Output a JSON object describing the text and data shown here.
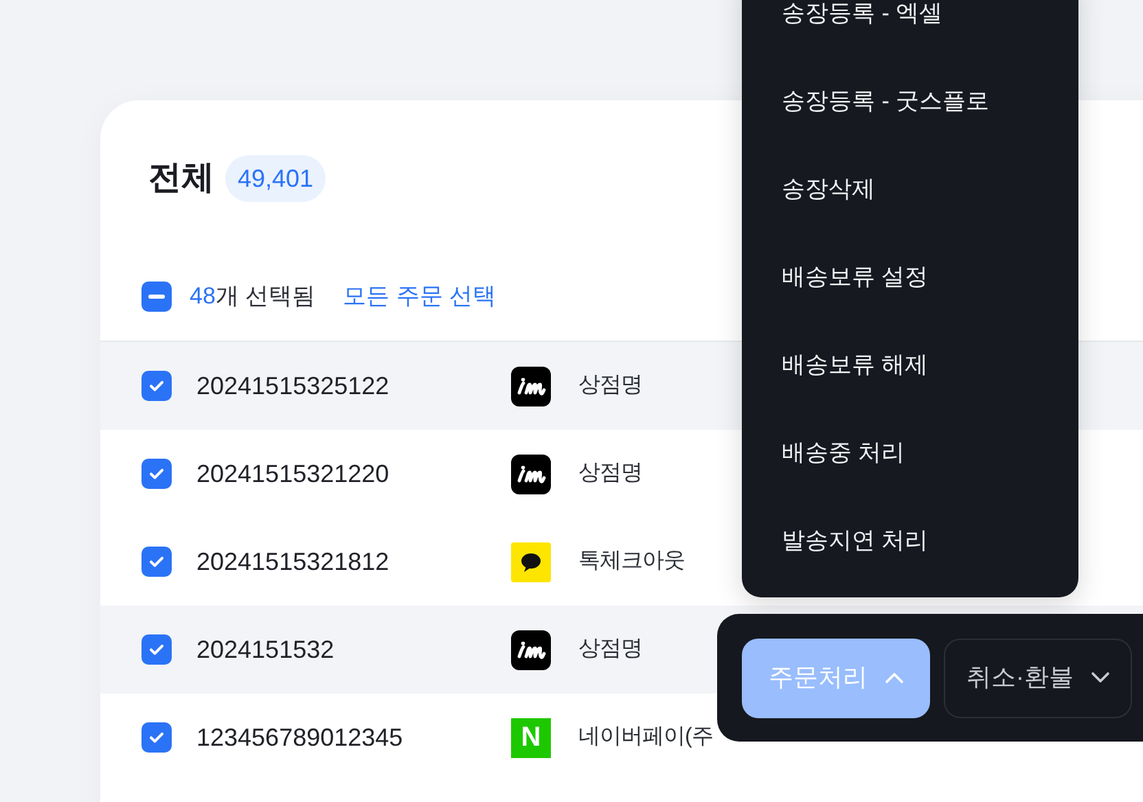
{
  "header": {
    "title": "전체",
    "count": "49,401"
  },
  "selection": {
    "partial": true,
    "count": "48",
    "suffix": "개 선택됨",
    "select_all": "모든 주문 선택"
  },
  "rows": [
    {
      "checked": true,
      "highlighted": true,
      "order_no": "20241515325122",
      "store": {
        "kind": "black",
        "name": "상점명"
      }
    },
    {
      "checked": true,
      "highlighted": false,
      "order_no": "20241515321220",
      "store": {
        "kind": "black",
        "name": "상점명"
      }
    },
    {
      "checked": true,
      "highlighted": false,
      "order_no": "20241515321812",
      "store": {
        "kind": "kakao",
        "name": "톡체크아웃"
      }
    },
    {
      "checked": true,
      "highlighted": true,
      "order_no": "2024151532",
      "store": {
        "kind": "black",
        "name": "상점명"
      }
    },
    {
      "checked": true,
      "highlighted": false,
      "order_no": "123456789012345",
      "store": {
        "kind": "naver",
        "logo_text": "N",
        "name": "네이버페이(주"
      }
    }
  ],
  "menu": {
    "items": [
      "송장등록 - 엑셀",
      "송장등록 - 굿스플로",
      "송장삭제",
      "배송보류 설정",
      "배송보류 해제",
      "배송중 처리",
      "발송지연 처리"
    ]
  },
  "action_bar": {
    "buttons": [
      {
        "label": "주문처리",
        "expanded": true,
        "primary": true
      },
      {
        "label": "취소·환불",
        "expanded": false,
        "primary": false
      }
    ]
  }
}
